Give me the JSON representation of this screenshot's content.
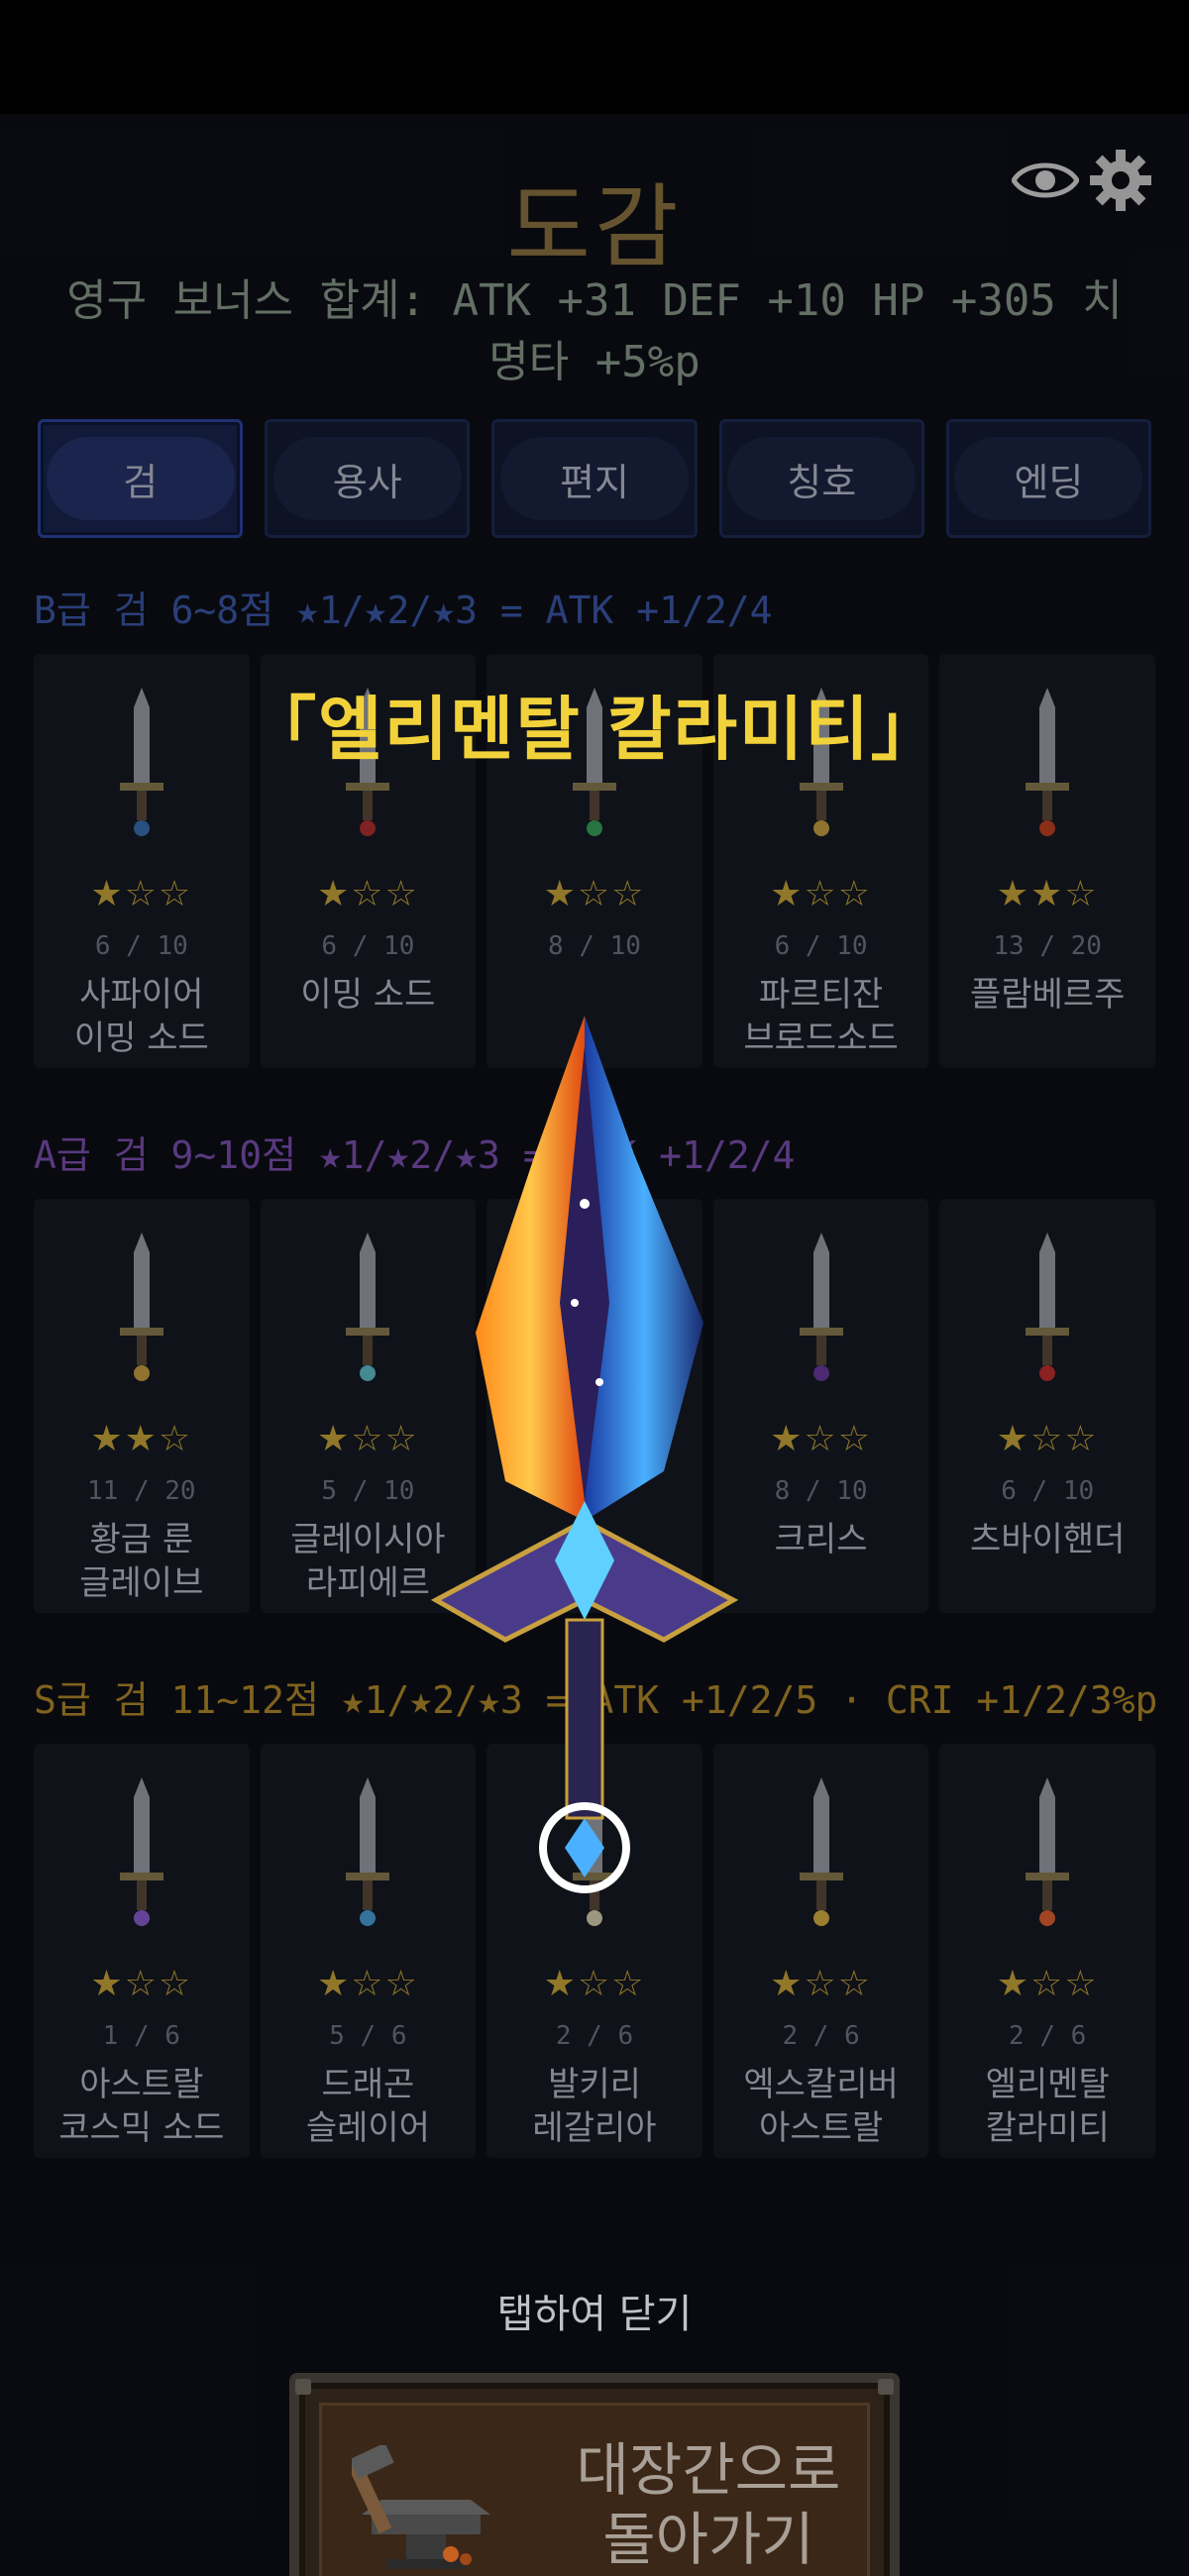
{
  "header": {
    "title": "도감",
    "eye_icon": "eye-icon",
    "settings_icon": "gear-icon"
  },
  "bonus_text": "영구 보너스 합계:  ATK +31   DEF +10   HP +305   치명타 +5%p",
  "tabs": [
    {
      "label": "검",
      "active": true
    },
    {
      "label": "용사",
      "active": false
    },
    {
      "label": "편지",
      "active": false
    },
    {
      "label": "칭호",
      "active": false
    },
    {
      "label": "엔딩",
      "active": false
    }
  ],
  "sections": [
    {
      "title": "B급 검  6~8점  ★1/★2/★3 = ATK +1/2/4",
      "color": "#3b58a8",
      "cards": [
        {
          "stars": "★☆☆",
          "count": "6 / 10",
          "name": "사파이어\n이밍 소드",
          "gem": "#3a6fb0"
        },
        {
          "stars": "★☆☆",
          "count": "6 / 10",
          "name": "이밍 소드",
          "gem": "#b03030"
        },
        {
          "stars": "★☆☆",
          "count": "8 / 10",
          "name": "",
          "gem": "#3aa05a"
        },
        {
          "stars": "★☆☆",
          "count": "6 / 10",
          "name": "파르티잔\n브로드소드",
          "gem": "#c8a040"
        },
        {
          "stars": "★★☆",
          "count": "13 / 20",
          "name": "플람베르주",
          "gem": "#c04020"
        }
      ]
    },
    {
      "title": "A급 검  9~10점   ★1/★2/★3 = ATK +1/2/4",
      "color": "#7c4fb0",
      "cards": [
        {
          "stars": "★★☆",
          "count": "11 / 20",
          "name": "황금 룬\n글레이브",
          "gem": "#c8a040"
        },
        {
          "stars": "★☆☆",
          "count": "5 / 10",
          "name": "글레이시아\n라피에르",
          "gem": "#5fc0c8"
        },
        {
          "stars": "",
          "count": "",
          "name": "",
          "gem": "#808080"
        },
        {
          "stars": "★☆☆",
          "count": "8 / 10",
          "name": "크리스",
          "gem": "#6a3aa0"
        },
        {
          "stars": "★☆☆",
          "count": "6 / 10",
          "name": "츠바이핸더",
          "gem": "#c03030"
        }
      ]
    },
    {
      "title": "S급 검  11~12점   ★1/★2/★3 = ATK +1/2/5  ·  CRI +1/2/3%p",
      "color": "#b08a2a",
      "cards": [
        {
          "stars": "★☆☆",
          "count": "1 / 6",
          "name": "아스트랄\n코스믹 소드",
          "gem": "#8a5fd0"
        },
        {
          "stars": "★☆☆",
          "count": "5 / 6",
          "name": "드래곤\n슬레이어",
          "gem": "#4aa0d8"
        },
        {
          "stars": "★☆☆",
          "count": "2 / 6",
          "name": "발키리\n레갈리아",
          "gem": "#d8d0b0"
        },
        {
          "stars": "★☆☆",
          "count": "2 / 6",
          "name": "엑스칼리버\n아스트랄",
          "gem": "#d8b040"
        },
        {
          "stars": "★☆☆",
          "count": "2 / 6",
          "name": "엘리멘탈\n칼라미티",
          "gem": "#e06030"
        }
      ]
    }
  ],
  "popup": {
    "selected_name": "「엘리멘탈 칼라미티」",
    "close_hint": "탭하여 닫기"
  },
  "forge_button": {
    "label": "대장간으로\n돌아가기",
    "icon": "anvil-icon"
  }
}
